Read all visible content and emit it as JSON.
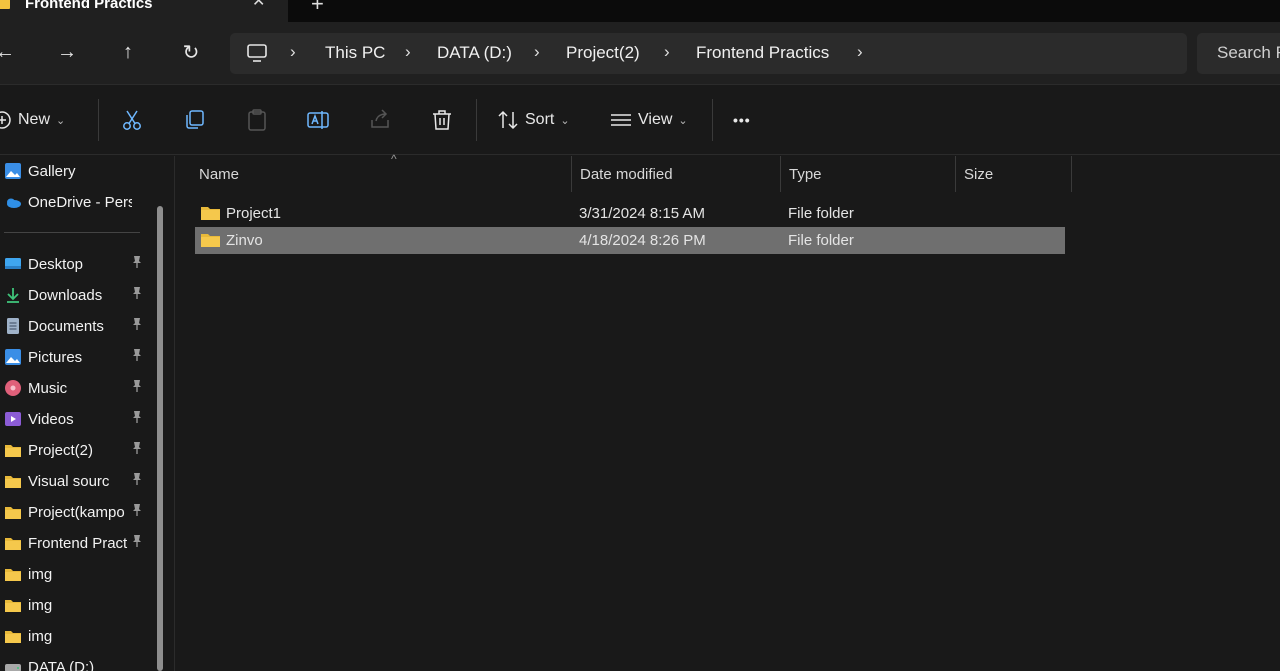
{
  "tab": {
    "title": "Frontend Practics",
    "close": "✕",
    "add": "+"
  },
  "nav": {
    "back": "←",
    "forward": "→",
    "up": "↑",
    "refresh": "↻",
    "breadcrumbs": [
      "This PC",
      "DATA (D:)",
      "Project(2)",
      "Frontend Practics"
    ],
    "chevron": "›",
    "search_placeholder": "Search F"
  },
  "toolbar": {
    "new_label": "New",
    "sort_label": "Sort",
    "view_label": "View",
    "more_label": "•••",
    "caret": "⌄"
  },
  "sidebar": {
    "items": [
      {
        "label": "Gallery",
        "icon": "gallery-icon",
        "pinned": false
      },
      {
        "label": "OneDrive - Persor",
        "icon": "onedrive-icon",
        "pinned": false
      },
      {
        "label": "Desktop",
        "icon": "desktop-icon",
        "pinned": true
      },
      {
        "label": "Downloads",
        "icon": "downloads-icon",
        "pinned": true
      },
      {
        "label": "Documents",
        "icon": "documents-icon",
        "pinned": true
      },
      {
        "label": "Pictures",
        "icon": "pictures-icon",
        "pinned": true
      },
      {
        "label": "Music",
        "icon": "music-icon",
        "pinned": true
      },
      {
        "label": "Videos",
        "icon": "videos-icon",
        "pinned": true
      },
      {
        "label": "Project(2)",
        "icon": "folder-icon",
        "pinned": true
      },
      {
        "label": "Visual sourc",
        "icon": "folder-icon",
        "pinned": true
      },
      {
        "label": "Project(kampo",
        "icon": "folder-icon",
        "pinned": true
      },
      {
        "label": "Frontend Pract",
        "icon": "folder-icon",
        "pinned": true
      },
      {
        "label": "img",
        "icon": "folder-icon",
        "pinned": false
      },
      {
        "label": "img",
        "icon": "folder-icon",
        "pinned": false
      },
      {
        "label": "img",
        "icon": "folder-icon",
        "pinned": false
      },
      {
        "label": "DATA (D:)",
        "icon": "drive-icon",
        "pinned": false
      }
    ],
    "pin_glyph": "📌"
  },
  "list": {
    "columns": [
      "Name",
      "Date modified",
      "Type",
      "Size"
    ],
    "sort_indicator": "^",
    "rows": [
      {
        "name": "Project1",
        "date": "3/31/2024 8:15 AM",
        "type": "File folder",
        "size": "",
        "selected": false
      },
      {
        "name": "Zinvo",
        "date": "4/18/2024 8:26 PM",
        "type": "File folder",
        "size": "",
        "selected": true
      }
    ]
  },
  "colors": {
    "background": "#191919",
    "chrome": "#202020",
    "selection": "#6f6f6f",
    "folder": "#f3c33f"
  }
}
